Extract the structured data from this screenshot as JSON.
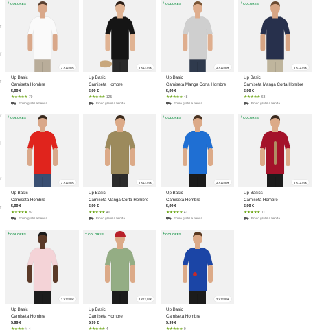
{
  "colors": {
    "accent_green": "#2e9e5a",
    "star_green": "#6fa81b",
    "photo_bg": "#f1f1f1"
  },
  "products": [
    {
      "colores": "COLORES",
      "price_pill": "3 X12,99€",
      "brand": "Up Basic",
      "title": "Camiseta Hombre",
      "price": "5,99 €",
      "rating": 5,
      "reviews": "79",
      "shipping": "Envío gratis a tienda",
      "shirt": "#fafafa",
      "pants": "#b9ad9a",
      "skin": "#d9a88a",
      "hair": "#5a4030"
    },
    {
      "colores": "",
      "price_pill": "3 X12,99€",
      "brand": "Up Basic",
      "title": "Camiseta Hombre",
      "price": "5,99 €",
      "rating": 5,
      "reviews": "125",
      "shipping": "Envío gratis a tienda",
      "shirt": "#151515",
      "pants": "#2a2a2a",
      "skin": "#e0b393",
      "hair": "#2a1c14"
    },
    {
      "colores": "COLORES",
      "price_pill": "3 X12,99€",
      "brand": "Up Basic",
      "title": "Camiseta Manga Corta Hombre",
      "price": "5,99 €",
      "rating": 5,
      "reviews": "48",
      "shipping": "Envío gratis a tienda",
      "shirt": "#cfcfcf",
      "pants": "#2f3a4d",
      "skin": "#dfae8e",
      "hair": "#7a5535"
    },
    {
      "colores": "COLORES",
      "price_pill": "3 X12,99€",
      "brand": "Up Basic",
      "title": "Camiseta Manga Corta Hombre",
      "price": "5,99 €",
      "rating": 5,
      "reviews": "68",
      "shipping": "Envío gratis a tienda",
      "shirt": "#27304c",
      "pants": "#bfb59d",
      "skin": "#d7a584",
      "hair": "#6b4a30"
    },
    {
      "colores": "COLORES",
      "price_pill": "3 X12,99€",
      "brand": "Up Basic",
      "title": "Camiseta Hombre",
      "price": "5,99 €",
      "rating": 5,
      "reviews": "92",
      "shipping": "Envío gratis a tienda",
      "shirt": "#e0241d",
      "pants": "#3a4f72",
      "skin": "#d9a88a",
      "hair": "#3a2a1e"
    },
    {
      "colores": "",
      "price_pill": "3 X12,99€",
      "brand": "Up Basic",
      "title": "Camiseta Manga Corta Hombre",
      "price": "5,99 €",
      "rating": 5,
      "reviews": "40",
      "shipping": "Envío gratis a tienda",
      "shirt": "#9c8a5c",
      "pants": "#2c2c2c",
      "skin": "#dcaa88",
      "hair": "#3b2a1c"
    },
    {
      "colores": "COLORES",
      "price_pill": "3 X12,99€",
      "brand": "Up Basic",
      "title": "Camiseta Hombre",
      "price": "5,99 €",
      "rating": 5,
      "reviews": "41",
      "shipping": "Envío gratis a tienda",
      "shirt": "#1f6fd3",
      "pants": "#1b1b1b",
      "skin": "#dcaa88",
      "hair": "#4a3322"
    },
    {
      "colores": "COLORES",
      "price_pill": "3 X12,99€",
      "brand": "Up Basics",
      "title": "Camiseta Hombre",
      "price": "5,99 €",
      "rating": 5,
      "reviews": "11",
      "shipping": "Envío gratis a tienda",
      "shirt": "#a4122a",
      "pants": "#1c1c1c",
      "skin": "#dcaa88",
      "hair": "#3a2a1e"
    },
    {
      "colores": "COLORES",
      "price_pill": "3 X12,99€",
      "brand": "Up Basic",
      "title": "Camiseta Hombre",
      "price": "5,99 €",
      "rating": 4,
      "reviews": "4",
      "shipping": "",
      "shirt": "#f4d3d7",
      "pants": "#1c1c1c",
      "skin": "#5b3a28",
      "hair": "#1a1a1a"
    },
    {
      "colores": "COLORES",
      "price_pill": "3 X12,99€",
      "brand": "Up Basic",
      "title": "Camiseta Hombre",
      "price": "5,99 €",
      "rating": 5,
      "reviews": "4",
      "shipping": "",
      "shirt": "#94ad84",
      "pants": "#1c1c1c",
      "skin": "#dcaa88",
      "hair": "#b8202a"
    },
    {
      "colores": "COLORES",
      "price_pill": "3 X12,99€",
      "brand": "Up Basic",
      "title": "Camiseta Hombre",
      "price": "5,99 €",
      "rating": 5,
      "reviews": "9",
      "shipping": "",
      "shirt": "#1b45a6",
      "pants": "#1c1c1c",
      "skin": "#dcaa88",
      "hair": "#5a3a22"
    }
  ]
}
